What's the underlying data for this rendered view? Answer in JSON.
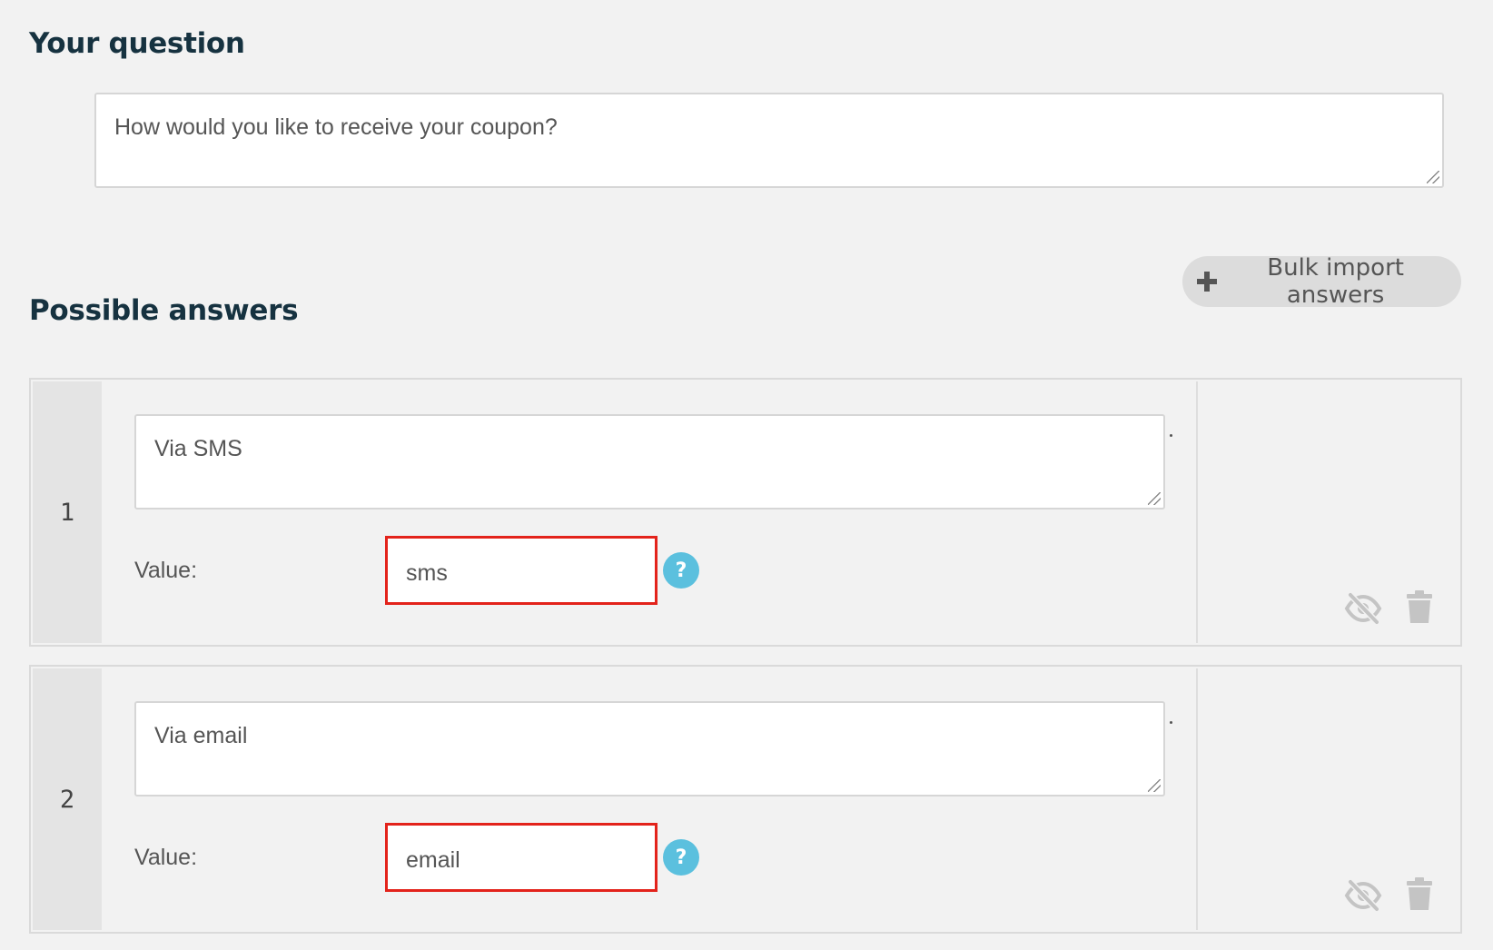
{
  "question_section": {
    "title": "Your question",
    "question_text": "How would you like to receive your coupon?"
  },
  "answers_section": {
    "title": "Possible answers",
    "bulk_import_label": "Bulk import answers",
    "value_label": "Value:",
    "help_icon_text": "?",
    "answers": [
      {
        "number": "1",
        "text": "Via SMS",
        "value": "sms"
      },
      {
        "number": "2",
        "text": "Via email",
        "value": "email"
      }
    ]
  },
  "colors": {
    "heading": "#163240",
    "highlight_border": "#e3231b",
    "help_icon": "#5bc0de",
    "background": "#f2f2f2"
  },
  "icons": [
    "plus-icon",
    "help-icon",
    "eye-slash-icon",
    "trash-icon"
  ]
}
